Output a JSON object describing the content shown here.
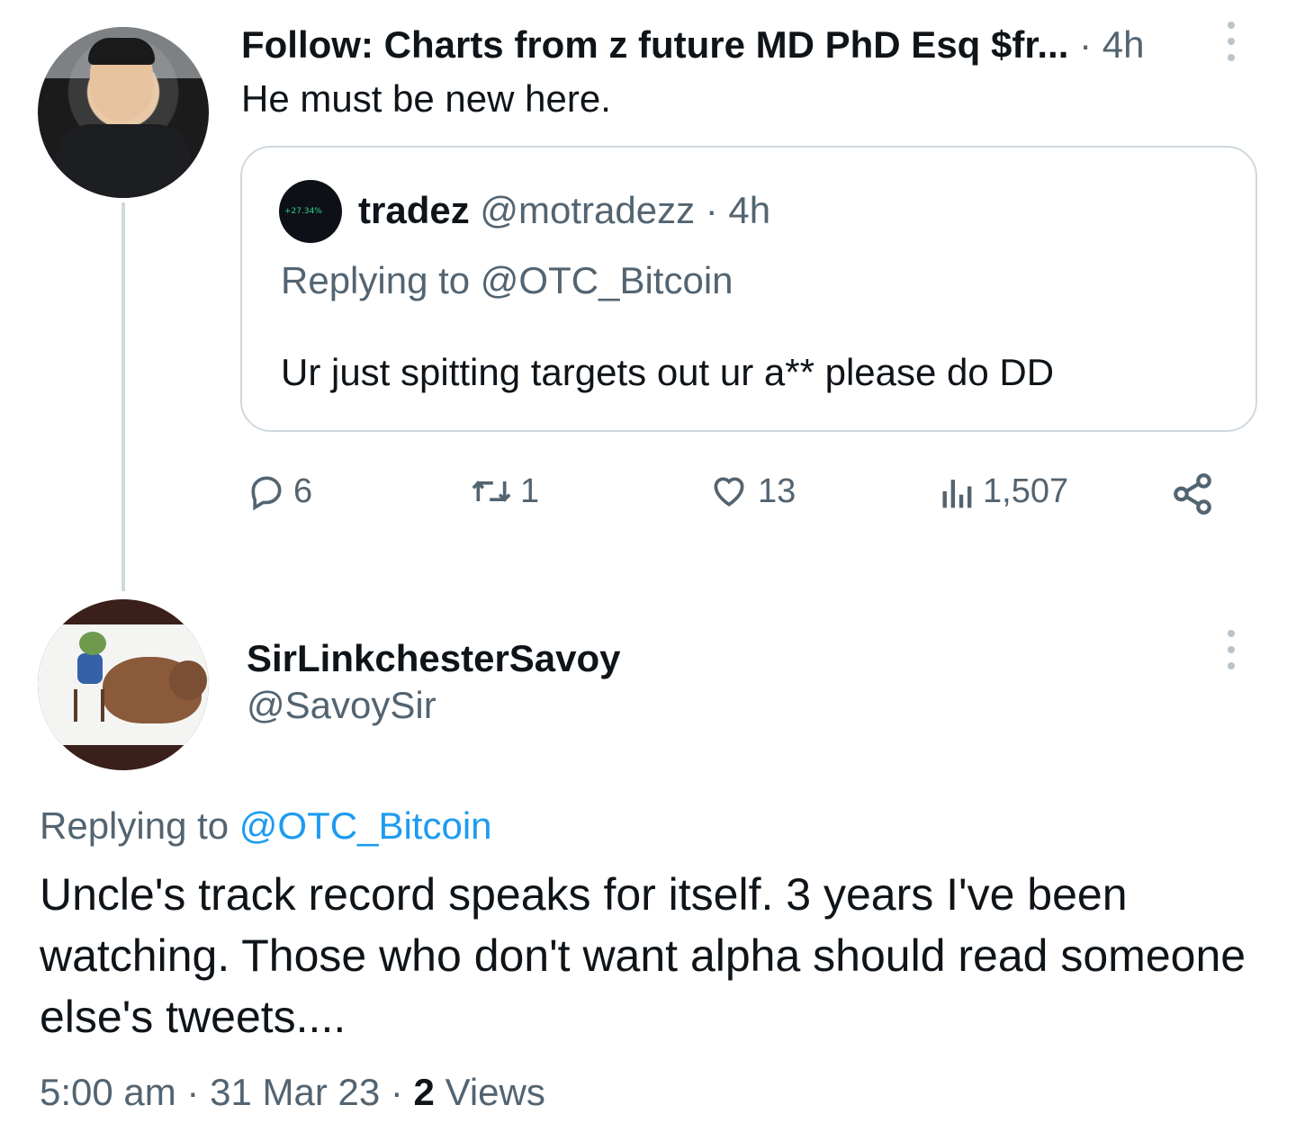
{
  "tweet1": {
    "author_display": "Follow: Charts from z future MD PhD Esq $fr...",
    "time": "4h",
    "text": "He must be new here.",
    "more_icon": "more-vertical-icon"
  },
  "quote": {
    "name": "tradez",
    "handle": "@motradezz",
    "time": "4h",
    "avatar_text": "+27.34%",
    "replying_label": "Replying to",
    "replying_to": "@OTC_Bitcoin",
    "text": "Ur just spitting targets out ur a** please do DD"
  },
  "actions": {
    "reply_count": "6",
    "retweet_count": "1",
    "like_count": "13",
    "views_count": "1,507",
    "icons": [
      "reply-icon",
      "retweet-icon",
      "like-icon",
      "views-icon",
      "share-icon"
    ]
  },
  "tweet2": {
    "name": "SirLinkchesterSavoy",
    "handle": "@SavoySir",
    "replying_label": "Replying to",
    "replying_to": "@OTC_Bitcoin",
    "text": "Uncle's track record speaks for itself. 3 years I've been watching. Those who don't want alpha should read someone else's tweets....",
    "time": "5:00 am",
    "date": "31 Mar 23",
    "views_count": "2",
    "views_label": "Views",
    "more_icon": "more-vertical-icon"
  },
  "colors": {
    "text": "#0f1419",
    "secondary": "#536471",
    "link": "#1d9bf0",
    "border": "#cfd9de"
  }
}
